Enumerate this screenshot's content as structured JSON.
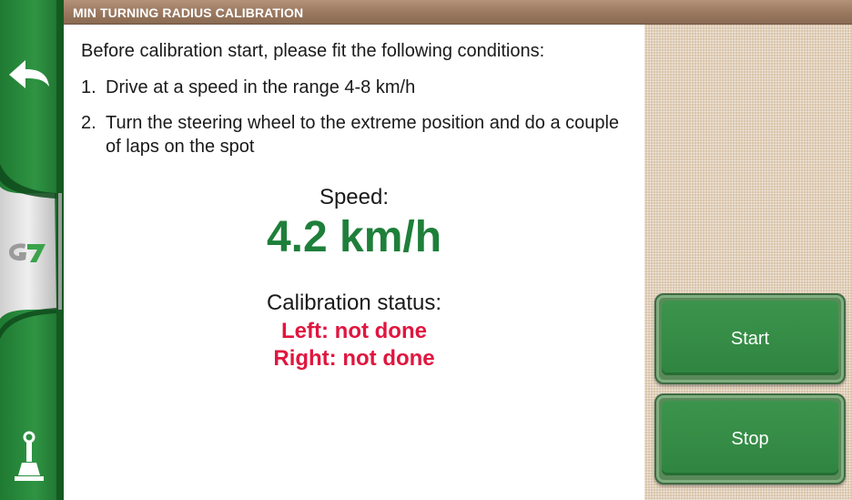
{
  "window": {
    "title": "MIN TURNING RADIUS CALIBRATION"
  },
  "sidebar": {
    "back_icon": "back-arrow-icon",
    "logo_icon": "g7-logo",
    "logo_text": "G7",
    "tool_icon": "joystick-icon"
  },
  "instructions": {
    "intro": "Before calibration start, please fit the following conditions:",
    "conditions": [
      {
        "number": "1.",
        "text": "Drive at a speed in the range 4-8 km/h"
      },
      {
        "number": "2.",
        "text": "Turn the steering wheel to the extreme position and do a couple of laps on the spot"
      }
    ]
  },
  "speed": {
    "label": "Speed:",
    "value": "4.2 km/h"
  },
  "calibration": {
    "label": "Calibration status:",
    "left": "Left: not done",
    "right": "Right: not done"
  },
  "buttons": {
    "start_label": "Start",
    "stop_label": "Stop"
  },
  "colors": {
    "sidebar_green": "#2e8b3f",
    "speed_green": "#1e7f3a",
    "status_red": "#e0163f",
    "title_brown": "#9a7860",
    "button_green": "#3c944c",
    "panel_beige": "#d9c4aa"
  }
}
